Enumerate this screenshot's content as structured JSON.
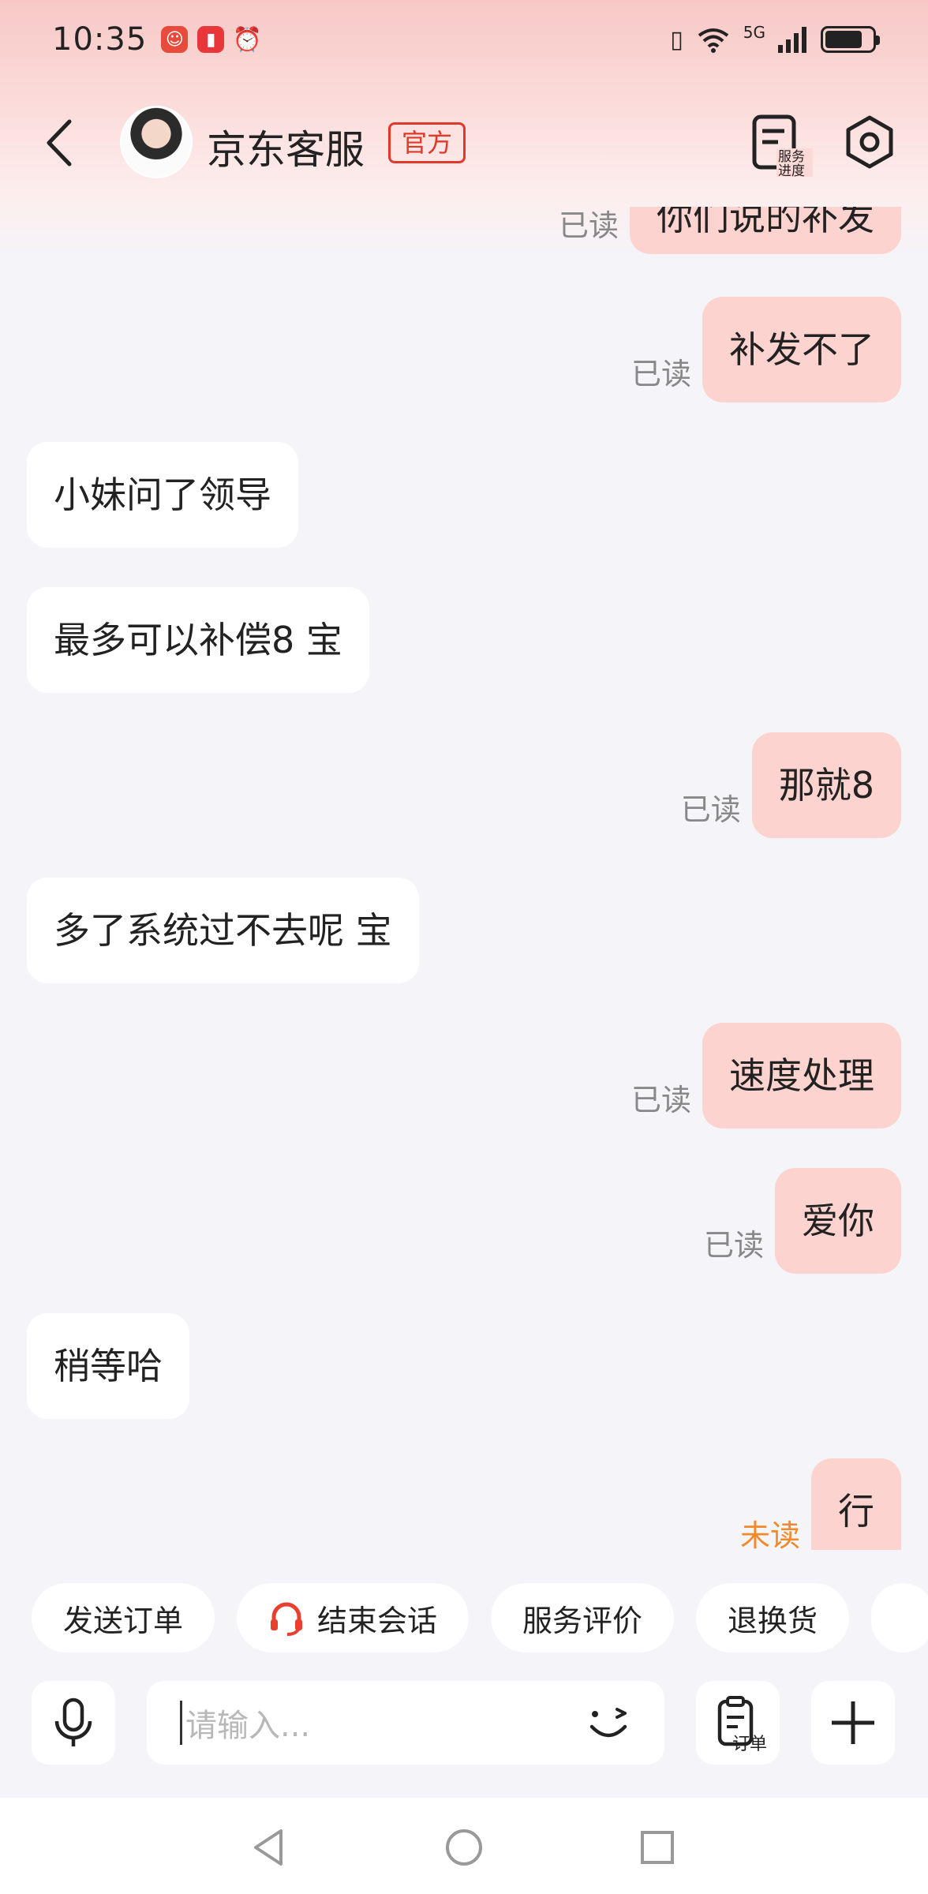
{
  "status_bar": {
    "time": "10:35",
    "network": "5G",
    "apps": [
      {
        "icon": "clown-app-icon",
        "color": "#e84b3c"
      },
      {
        "icon": "red-book-app-icon",
        "color": "#e8363a"
      },
      {
        "icon": "alarm-icon",
        "color": "#333333"
      }
    ]
  },
  "header": {
    "title": "京东客服",
    "badge": "官方",
    "service_progress_label": "服务\n进度"
  },
  "messages": [
    {
      "side": "out",
      "text": "你们说的补发",
      "status": "已读"
    },
    {
      "side": "out",
      "text": "补发不了",
      "status": "已读"
    },
    {
      "side": "in",
      "text": "小妹问了领导"
    },
    {
      "side": "in",
      "text": "最多可以补偿8  宝"
    },
    {
      "side": "out",
      "text": "那就8",
      "status": "已读"
    },
    {
      "side": "in",
      "text": "多了系统过不去呢 宝"
    },
    {
      "side": "out",
      "text": "速度处理",
      "status": "已读"
    },
    {
      "side": "out",
      "text": "爱你",
      "status": "已读"
    },
    {
      "side": "in",
      "text": "稍等哈"
    },
    {
      "side": "out",
      "text": "行",
      "status": "未读"
    }
  ],
  "quick_actions": [
    "发送订单",
    "结束会话",
    "服务评价",
    "退换货"
  ],
  "input": {
    "placeholder": "请输入...",
    "order_label": "订单"
  },
  "colors": {
    "out_bubble": "#fdd3cf",
    "in_bubble": "#ffffff",
    "badge": "#e0392b",
    "unread": "#f08a2a"
  }
}
